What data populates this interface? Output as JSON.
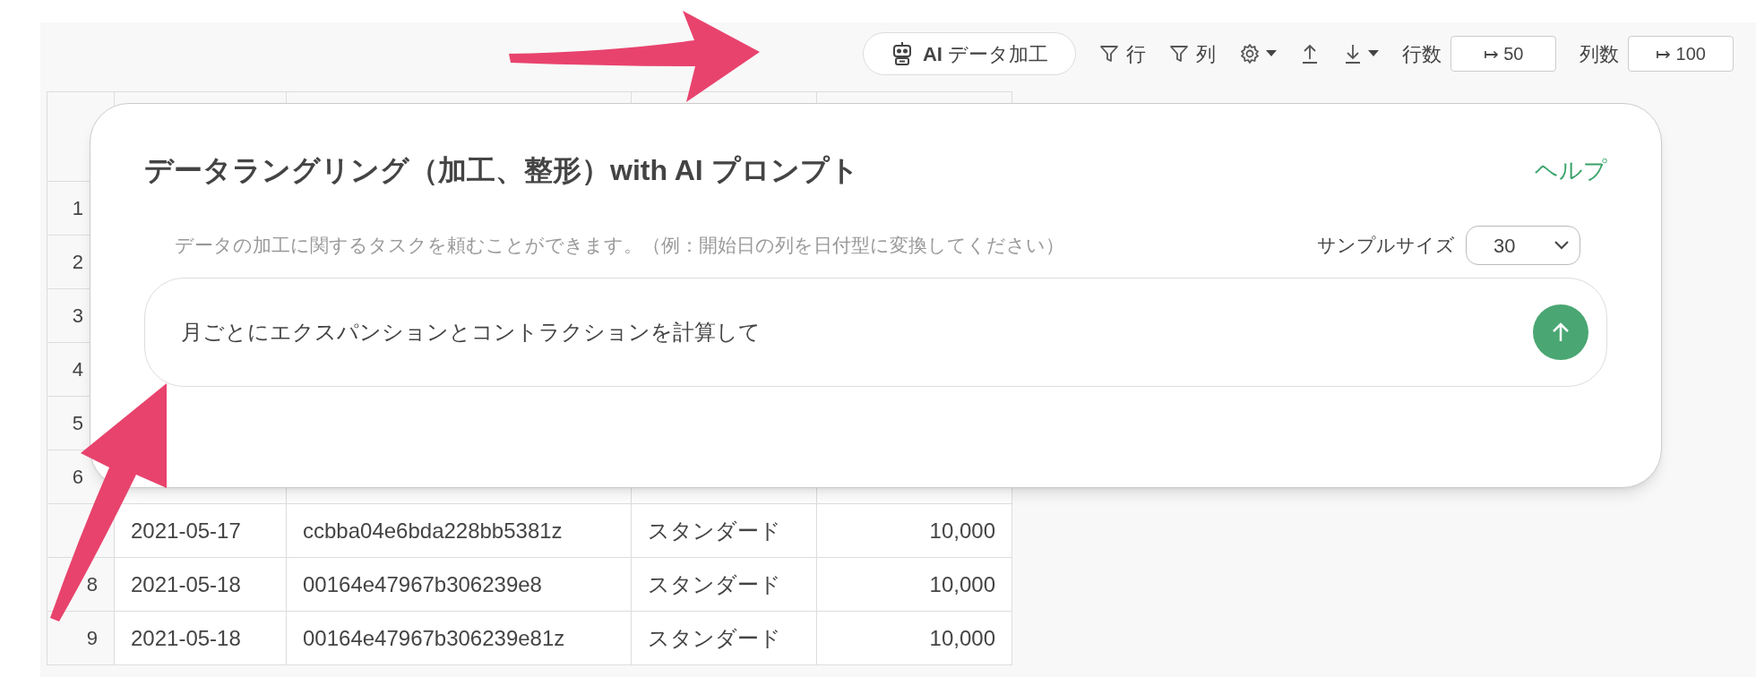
{
  "toolbar": {
    "ai_button": {
      "badge": "AI",
      "label": "データ加工"
    },
    "row_filter": "行",
    "column_filter": "列",
    "row_count": {
      "label": "行数",
      "value": "↦ 50"
    },
    "column_count": {
      "label": "列数",
      "value": "↦ 100"
    }
  },
  "table": {
    "rows": [
      {
        "number": "1"
      },
      {
        "number": "2"
      },
      {
        "number": "3"
      },
      {
        "number": "4"
      },
      {
        "number": "5"
      },
      {
        "number": "6"
      },
      {
        "cells": [
          "2021-05-17",
          "ccbba04e6bda228bb5381z",
          "スタンダード",
          "10,000"
        ]
      },
      {
        "number": "8",
        "cells": [
          "2021-05-18",
          "00164e47967b306239e8",
          "スタンダード",
          "10,000"
        ]
      },
      {
        "number": "9",
        "cells": [
          "2021-05-18",
          "00164e47967b306239e81z",
          "スタンダード",
          "10,000"
        ]
      }
    ]
  },
  "dialog": {
    "title": "データラングリング（加工、整形）with AI プロンプト",
    "help_link": "ヘルプ",
    "hint": "データの加工に関するタスクを頼むことができます。（例：開始日の列を日付型に変換してください）",
    "sample_size": {
      "label": "サンプルサイズ",
      "value": "30"
    },
    "prompt": {
      "value": "月ごとにエクスパンションとコントラクションを計算して"
    }
  }
}
